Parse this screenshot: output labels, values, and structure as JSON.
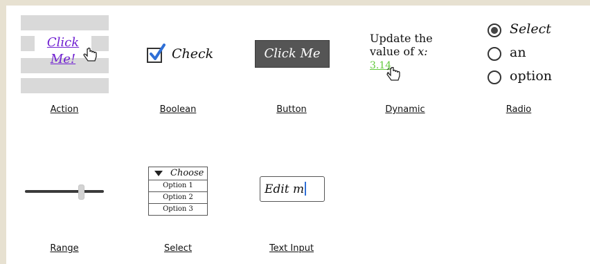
{
  "action": {
    "link": "Click Me!",
    "caption": "Action"
  },
  "boolean": {
    "label": "Check",
    "caption": "Boolean",
    "checked": true
  },
  "button": {
    "label": "Click Me",
    "caption": "Button"
  },
  "dynamic": {
    "line1": "Update the",
    "line2_prefix": "value of ",
    "variable": "x:",
    "value": "3.14",
    "punct": ".",
    "caption": "Dynamic"
  },
  "radio": {
    "options": [
      "Select",
      "an",
      "option"
    ],
    "selected_index": 0,
    "caption": "Radio"
  },
  "range": {
    "caption": "Range",
    "value_fraction": 0.73
  },
  "select": {
    "selected": "Choose",
    "options": [
      "Option 1",
      "Option 2",
      "Option 3"
    ],
    "caption": "Select"
  },
  "text_input": {
    "value": "Edit m",
    "caption": "Text Input"
  },
  "colors": {
    "accent_link": "#6f1fd1",
    "dynamic_value": "#61c93b",
    "caret": "#2f6fd6"
  }
}
